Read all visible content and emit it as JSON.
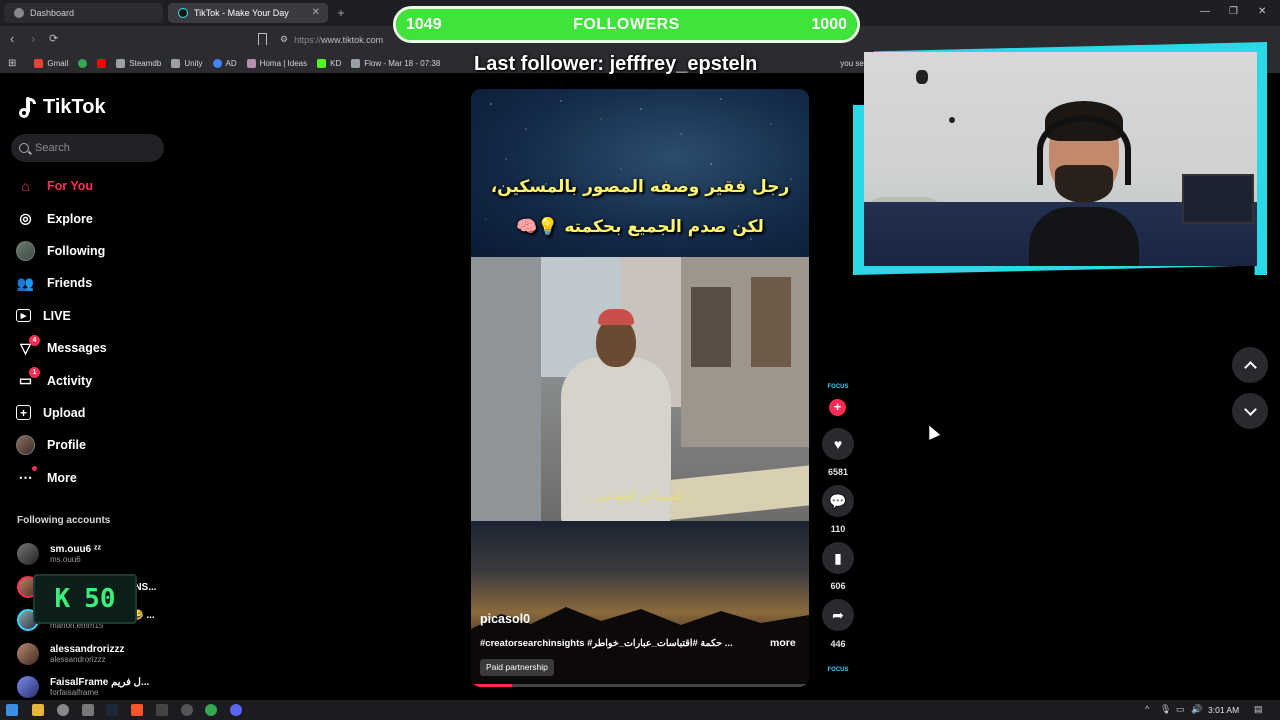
{
  "browser": {
    "tabs": [
      {
        "label": "Dashboard"
      },
      {
        "label": "TikTok - Make Your Day"
      }
    ],
    "url": "https://www.tiktok.com",
    "url_prefix": "https://",
    "url_host": "www.tiktok.com",
    "bookmarks": [
      {
        "label": "Gmail",
        "color": "#ea4335"
      },
      {
        "label": "",
        "color": "#34a853"
      },
      {
        "label": "",
        "color": "#ff0000"
      },
      {
        "label": "Steamdb",
        "color": "#9aa0a6"
      },
      {
        "label": "Unity",
        "color": "#9aa0a6"
      },
      {
        "label": "AD",
        "color": "#4285f4"
      },
      {
        "label": "Homa | Ideas",
        "color": "#b48ead"
      },
      {
        "label": "KD",
        "color": "#53fc18"
      },
      {
        "label": "Flow - Mar 18 - 07:38",
        "color": "#9aa0a6"
      }
    ],
    "bookmark_tail": "you searched for cit..."
  },
  "overlay": {
    "followers_current": "1049",
    "followers_label": "FOLLOWERS",
    "followers_goal": "1000",
    "followers_fill_fraction": 1.0,
    "last_follower": "Last follower: jefffrey_epsteln",
    "kick_label": "K",
    "kick_value": "50",
    "colors": {
      "bar_fill": "#3fe33a",
      "cam_frame": "#2ad8e6"
    }
  },
  "tiktok": {
    "logo_text": "TikTok",
    "search_placeholder": "Search",
    "nav": [
      {
        "label": "For You",
        "icon": "home-icon",
        "active": true
      },
      {
        "label": "Explore",
        "icon": "compass-icon"
      },
      {
        "label": "Following",
        "icon": "avatar-icon"
      },
      {
        "label": "Friends",
        "icon": "friends-icon"
      },
      {
        "label": "LIVE",
        "icon": "live-icon"
      },
      {
        "label": "Messages",
        "icon": "send-icon",
        "badge": "4"
      },
      {
        "label": "Activity",
        "icon": "activity-icon",
        "badge": "1"
      },
      {
        "label": "Upload",
        "icon": "plus-box-icon"
      },
      {
        "label": "Profile",
        "icon": "profile-avatar-icon"
      },
      {
        "label": "More",
        "icon": "more-icon"
      }
    ],
    "following_title": "Following accounts",
    "following_accounts": [
      {
        "name": "sm.ouu6 ᶻᶻ",
        "user": "ms.ouu6"
      },
      {
        "name": "...NS...",
        "user": ""
      },
      {
        "name": "... 😂 ...",
        "user": "manon.emm15"
      },
      {
        "name": "alessandrorizzz",
        "user": "alessandrorizzz"
      },
      {
        "name": "FaisalFrame ل فريم...",
        "user": "forfaisalframe"
      }
    ],
    "video": {
      "caption_line1": "رجل فقير وصفه المصور بالمسكين،",
      "caption_line2": "لكن صدم الجميع بحكمته 💡🧠",
      "subtitle": "... المسكين الحقيقي ...",
      "author": "picasol0",
      "description": "#creatorsearchinsights #حكمة #اقتباسات_عبارات_خواطر ...",
      "more": "more",
      "paid": "Paid partnership",
      "progress": 0.12
    },
    "actions": {
      "focus_label": "FOCUS",
      "likes": "6581",
      "comments": "110",
      "saves": "606",
      "shares": "446"
    }
  },
  "taskbar": {
    "time": "3:01 AM"
  }
}
